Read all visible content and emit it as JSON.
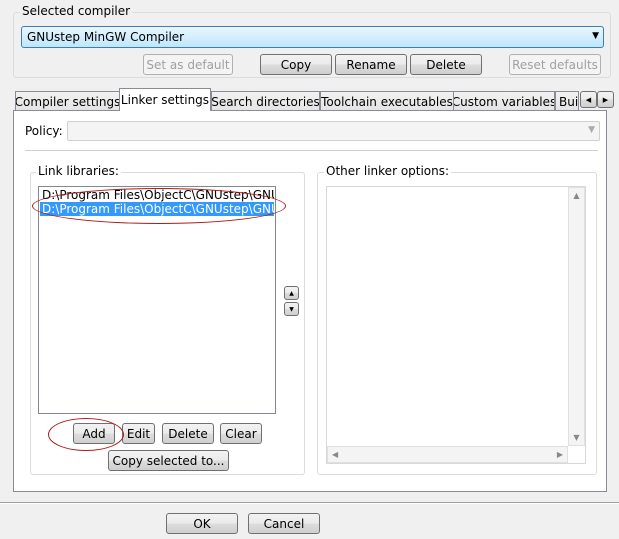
{
  "selected_compiler": {
    "label": "Selected compiler",
    "value": "GNUstep MinGW Compiler",
    "buttons": {
      "set_default": "Set as default",
      "copy": "Copy",
      "rename": "Rename",
      "delete": "Delete",
      "reset": "Reset defaults"
    }
  },
  "tabs": [
    {
      "label": "Compiler settings"
    },
    {
      "label": "Linker settings",
      "selected": true
    },
    {
      "label": "Search directories"
    },
    {
      "label": "Toolchain executables"
    },
    {
      "label": "Custom variables"
    },
    {
      "label": "Bui"
    }
  ],
  "linker": {
    "policy_label": "Policy:",
    "policy_value": "",
    "link_libraries": {
      "label": "Link libraries:",
      "items": [
        "D:\\Program Files\\ObjectC\\GNUstep\\GNUstep\\System\\Library\\Libraries\\libobjc.dll.a",
        "D:\\Program Files\\ObjectC\\GNUstep\\GNUstep\\System\\Library\\Libraries\\libgnustep-base.dll.a"
      ],
      "selected_index": 1,
      "buttons": {
        "add": "Add",
        "edit": "Edit",
        "delete": "Delete",
        "clear": "Clear",
        "copy_to": "Copy selected to..."
      }
    },
    "other_options": {
      "label": "Other linker options:",
      "value": ""
    }
  },
  "footer": {
    "ok": "OK",
    "cancel": "Cancel"
  },
  "colors": {
    "selection": "#3399ff",
    "annotation": "#b01818"
  }
}
